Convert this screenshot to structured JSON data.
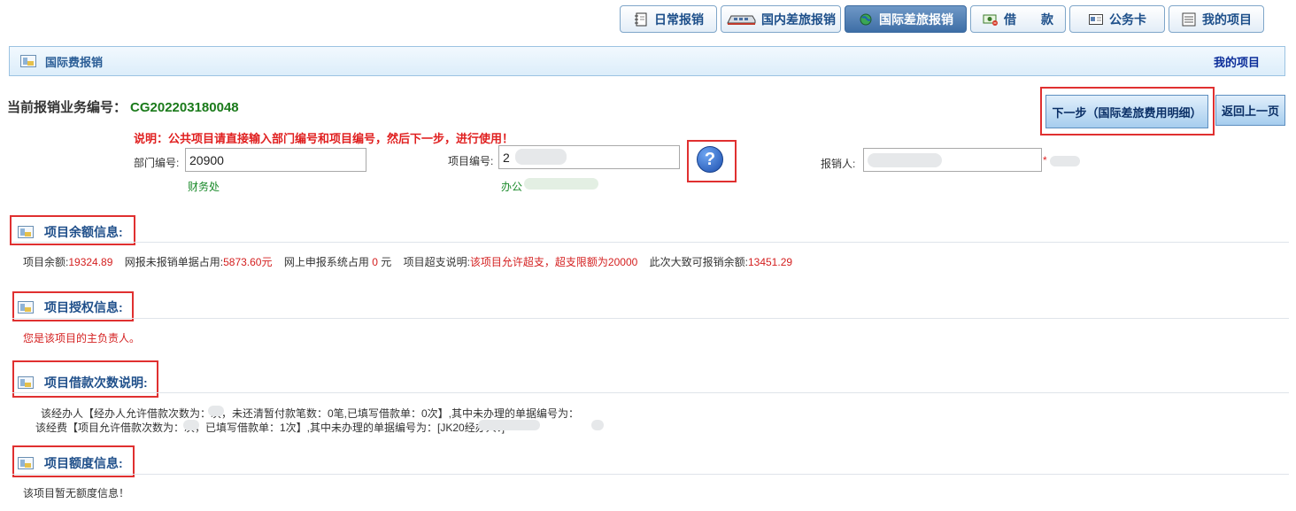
{
  "tabs": [
    {
      "label": "日常报销",
      "icon": "notebook-icon",
      "active": false
    },
    {
      "label": "国内差旅报销",
      "icon": "train-icon",
      "active": false
    },
    {
      "label": "国际差旅报销",
      "icon": "globe-icon",
      "active": true
    },
    {
      "label": "借　　款",
      "icon": "loan-icon",
      "active": false
    },
    {
      "label": "公务卡",
      "icon": "card-icon",
      "active": false
    },
    {
      "label": "我的项目",
      "icon": "list-icon",
      "active": false
    }
  ],
  "header": {
    "title": "国际费报销",
    "my_projects": "我的项目"
  },
  "business": {
    "label": "当前报销业务编号：",
    "number": "CG202203180048"
  },
  "buttons": {
    "next": "下一步（国际差旅费用明细）",
    "back": "返回上一页"
  },
  "notice": "说明：公共项目请直接输入部门编号和项目编号，然后下一步，进行使用！",
  "form": {
    "dept_label": "部门编号:",
    "dept_value": "20900",
    "dept_name": "财务处",
    "project_label": "项目编号:",
    "project_value": "2",
    "project_name": "办公",
    "person_label": "报销人:",
    "person_value": "",
    "required_mark": "*"
  },
  "sections": {
    "balance": {
      "title": "项目余额信息:",
      "balance_label": "项目余额:",
      "balance_value": "19324.89",
      "unpaid_label": "网报未报销单据占用:",
      "unpaid_value": "5873.60元",
      "online_label": "网上申报系统占用",
      "online_value": "0",
      "online_unit": "元",
      "overdraft_label": "项目超支说明:",
      "overdraft_value": "该项目允许超支，超支限额为20000",
      "available_label": "此次大致可报销余额:",
      "available_value": "13451.29"
    },
    "auth": {
      "title": "项目授权信息:",
      "text": "您是该项目的主负责人。"
    },
    "loan": {
      "title": "项目借款次数说明:",
      "line1": "该经办人【经办人允许借款次数为：次，未还清暂付款笔数：0笔,已填写借款单：0次】,其中未办理的单据编号为：",
      "line2": "该经费【项目允许借款次数为：次，已填写借款单：1次】,其中未办理的单据编号为：[JK20经办人：]"
    },
    "quota": {
      "title": "项目额度信息:",
      "text": "该项目暂无额度信息！"
    }
  }
}
